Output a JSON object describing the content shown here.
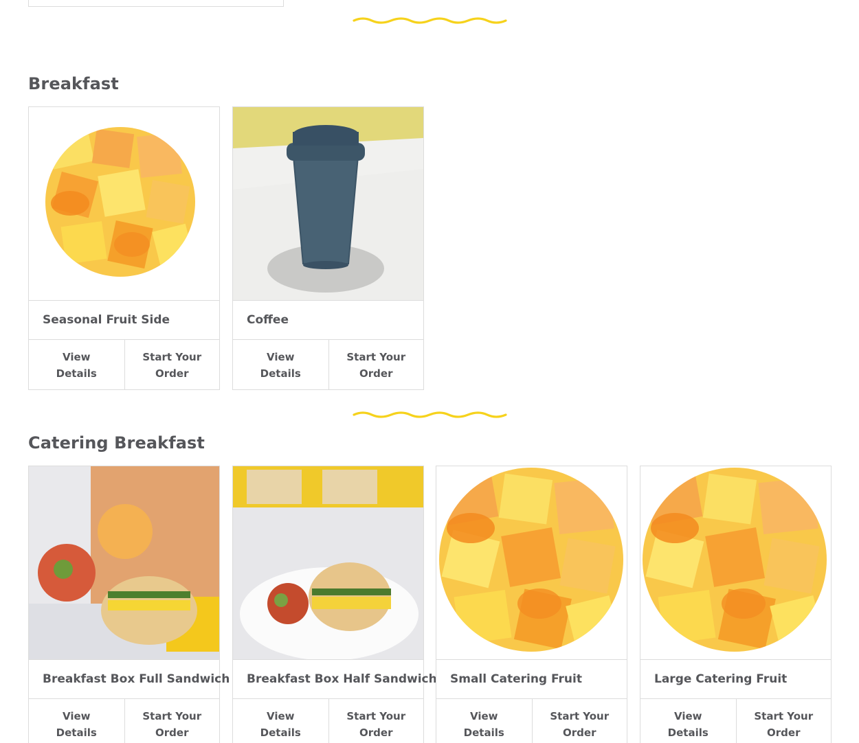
{
  "sections": [
    {
      "title": "Breakfast",
      "items": [
        {
          "name": "Seasonal Fruit Side",
          "view_label": "View Details",
          "order_label": "Start Your Order",
          "image": "fruit-cup-icon"
        },
        {
          "name": "Coffee",
          "view_label": "View Details",
          "order_label": "Start Your Order",
          "image": "coffee-cup-icon"
        }
      ]
    },
    {
      "title": "Catering Breakfast",
      "items": [
        {
          "name": "Breakfast Box Full Sandwich",
          "view_label": "View Details",
          "order_label": "Start Your Order",
          "image": "sandwich-box-icon"
        },
        {
          "name": "Breakfast Box Half Sandwich",
          "view_label": "View Details",
          "order_label": "Start Your Order",
          "image": "sandwich-plate-icon"
        },
        {
          "name": "Small Catering Fruit",
          "view_label": "View Details",
          "order_label": "Start Your Order",
          "image": "fruit-cup-icon"
        },
        {
          "name": "Large Catering Fruit",
          "view_label": "View Details",
          "order_label": "Start Your Order",
          "image": "fruit-cup-icon"
        }
      ]
    }
  ],
  "colors": {
    "accent_squiggle": "#f6d21c",
    "text": "#55565a",
    "border": "#dcdcdc"
  }
}
